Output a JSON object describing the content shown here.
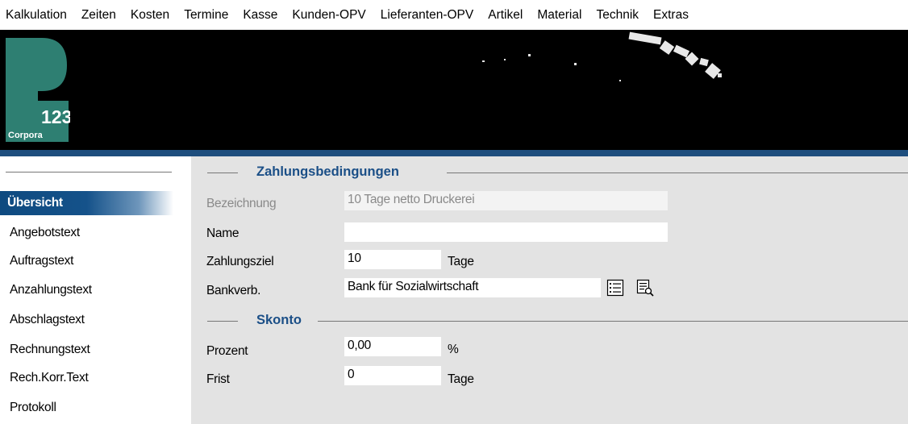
{
  "menu": [
    "Kalkulation",
    "Zeiten",
    "Kosten",
    "Termine",
    "Kasse",
    "Kunden-OPV",
    "Lieferanten-OPV",
    "Artikel",
    "Material",
    "Technik",
    "Extras"
  ],
  "logo": {
    "number": "123",
    "brand": "Corpora"
  },
  "sidebar": {
    "items": [
      {
        "label": "Übersicht",
        "active": true
      },
      {
        "label": "Angebotstext"
      },
      {
        "label": "Auftragstext"
      },
      {
        "label": "Anzahlungstext"
      },
      {
        "label": "Abschlagstext"
      },
      {
        "label": "Rechnungstext"
      },
      {
        "label": "Rech.Korr.Text"
      },
      {
        "label": "Protokoll"
      }
    ]
  },
  "zahlung": {
    "title": "Zahlungsbedingungen",
    "bezeichnung_label": "Bezeichnung",
    "bezeichnung_value": "10 Tage netto Druckerei",
    "name_label": "Name",
    "name_value": "",
    "ziel_label": "Zahlungsziel",
    "ziel_value": "10",
    "ziel_unit": "Tage",
    "bank_label": "Bankverb.",
    "bank_value": "Bank für Sozialwirtschaft"
  },
  "skonto": {
    "title": "Skonto",
    "prozent_label": "Prozent",
    "prozent_value": "0,00",
    "prozent_unit": "%",
    "frist_label": "Frist",
    "frist_value": "0",
    "frist_unit": "Tage"
  },
  "colors": {
    "accent": "#1b4f87",
    "banner": "#000000",
    "logo_green": "#2e7f72"
  },
  "icons": [
    "list-icon",
    "list-search-icon"
  ]
}
